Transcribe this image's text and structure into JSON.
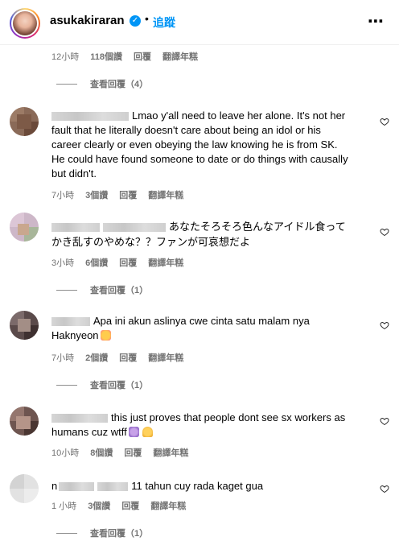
{
  "header": {
    "username": "asukakiraran",
    "separator": "•",
    "follow_label": "追蹤",
    "more_label": "⋯"
  },
  "top_meta": {
    "time": "12小時",
    "likes": "118個讚",
    "reply": "回覆",
    "translate": "翻譯年糕",
    "view_replies": "查看回覆（4）"
  },
  "comments": [
    {
      "text": "Lmao y'all need to leave her alone. It's not her fault that he literally doesn't care about being an idol or his career clearly or even obeying the law knowing he is from SK. He could have found someone to date or do things with causally but didn't.",
      "time": "7小時",
      "likes": "3個讚",
      "reply": "回覆",
      "translate": "翻譯年糕"
    },
    {
      "text": "あなたそろそろ色んなアイドル食ってかき乱すのやめな？？ファンが可哀想だよ",
      "time": "3小時",
      "likes": "6個讚",
      "reply": "回覆",
      "translate": "翻譯年糕",
      "view_replies": "查看回覆（1）"
    },
    {
      "text": "Apa ini akun aslinya cwe cinta satu malam nya Haknyeon",
      "time": "7小時",
      "likes": "2個讚",
      "reply": "回覆",
      "translate": "翻譯年糕",
      "view_replies": "查看回覆（1）"
    },
    {
      "text": "this just proves that people dont see sx workers as humans cuz wtff",
      "time": "10小時",
      "likes": "8個讚",
      "reply": "回覆",
      "translate": "翻譯年糕"
    },
    {
      "name_prefix": "n",
      "text": "11 tahun cuy rada kaget gua",
      "time": "1 小時",
      "likes": "3個讚",
      "reply": "回覆",
      "translate": "翻譯年糕",
      "view_replies": "查看回覆（1）"
    }
  ],
  "colors": {
    "link_blue": "#0095f6",
    "meta_gray": "#737373"
  },
  "icons": [
    "verified-badge-icon",
    "more-options-icon",
    "heart-icon",
    "blushing-emoji-icon",
    "crying-emoji-icon",
    "praying-hands-emoji-icon"
  ]
}
